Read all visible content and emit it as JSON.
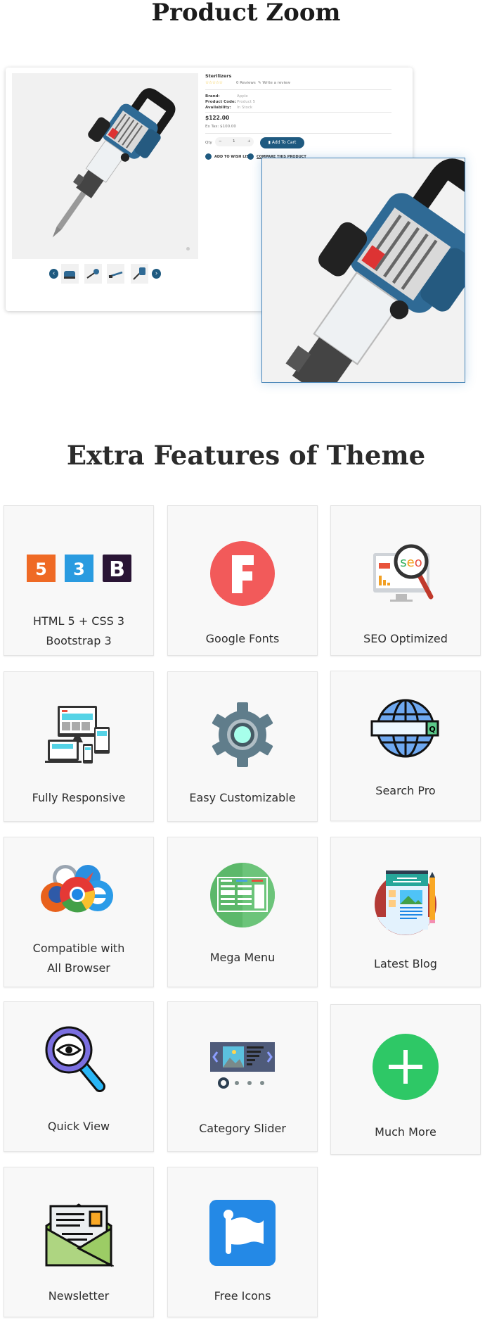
{
  "product_zoom": {
    "title": "Product Zoom",
    "product": {
      "name": "Sterilizers",
      "stars": "☆☆☆☆☆",
      "rating": 0,
      "reviews": "0 Reviews",
      "write_review": "Write a review",
      "brand_label": "Brand:",
      "brand": "Apple",
      "code_label": "Product Code:",
      "code": "Product 5",
      "availability_label": "Availability:",
      "availability": "In Stock",
      "price": "$122.00",
      "ex_tax": "Ex Tax: $100.00",
      "qty_label": "Qty",
      "qty_minus": "−",
      "qty": "1",
      "qty_plus": "+",
      "add_to_cart": "Add To Cart",
      "wishlist": "ADD TO WISH LIST",
      "compare": "COMPARE THIS PRODUCT",
      "prev": "‹",
      "next": "›"
    },
    "accent": "#1f5a80"
  },
  "features": {
    "title": "Extra Features of Theme",
    "items": [
      {
        "icon": "html-css-bootstrap-icon",
        "lines": [
          "HTML 5 + CSS 3",
          "Bootstrap 3"
        ]
      },
      {
        "icon": "google-fonts-icon",
        "lines": [
          "Google Fonts"
        ]
      },
      {
        "icon": "seo-icon",
        "lines": [
          "SEO Optimized"
        ]
      },
      {
        "icon": "responsive-devices-icon",
        "lines": [
          "Fully Responsive"
        ]
      },
      {
        "icon": "gear-icon",
        "lines": [
          "Easy Customizable"
        ]
      },
      {
        "icon": "globe-search-icon",
        "lines": [
          "Search Pro"
        ]
      },
      {
        "icon": "browsers-icon",
        "lines": [
          "Compatible with",
          "All Browser"
        ]
      },
      {
        "icon": "mega-menu-icon",
        "lines": [
          "Mega Menu"
        ]
      },
      {
        "icon": "blog-icon",
        "lines": [
          "Latest Blog"
        ]
      },
      {
        "icon": "quick-view-icon",
        "lines": [
          "Quick View"
        ]
      },
      {
        "icon": "slider-icon",
        "lines": [
          "Category Slider"
        ]
      },
      {
        "icon": "plus-icon",
        "lines": [
          "Much More"
        ]
      },
      {
        "icon": "newsletter-icon",
        "lines": [
          "Newsletter"
        ]
      },
      {
        "icon": "flag-icon",
        "lines": [
          "Free Icons"
        ]
      }
    ]
  }
}
